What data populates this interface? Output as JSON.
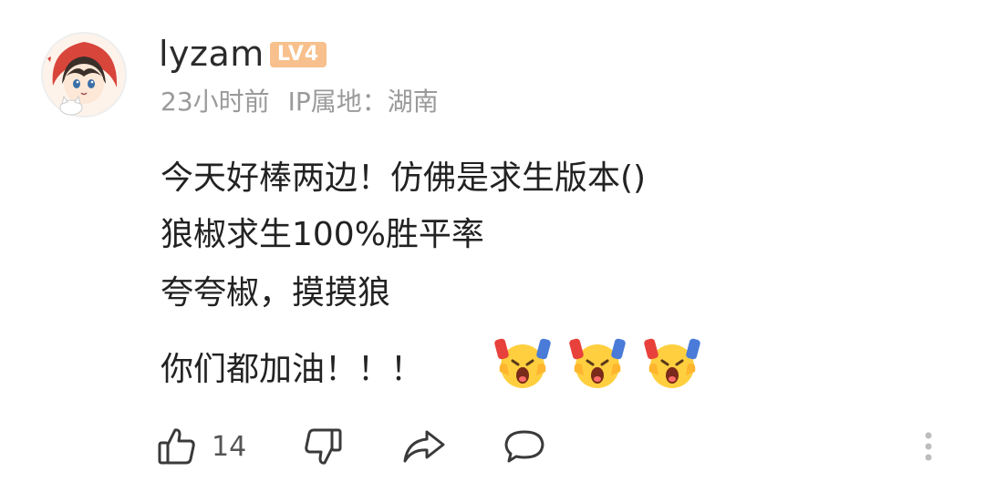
{
  "comment": {
    "username": "lyzam",
    "level_badge": "LV4",
    "time": "23小时前",
    "ip_location": "IP属地：湖南",
    "lines": [
      "今天好棒两边！仿佛是求生版本()",
      "狼椒求生100%胜平率",
      "夸夸椒，摸摸狼",
      "你们都加油！！！"
    ],
    "emojis": [
      "cheering-emoji",
      "cheering-emoji",
      "cheering-emoji"
    ],
    "like_count": "14"
  },
  "icons": {
    "like": "thumbs-up-icon",
    "dislike": "thumbs-down-icon",
    "share": "share-icon",
    "comment": "comment-icon",
    "more": "more-vertical-icon"
  },
  "colors": {
    "badge": "#f7c08c",
    "meta_text": "#9a9a9a",
    "body_text": "#222222"
  }
}
